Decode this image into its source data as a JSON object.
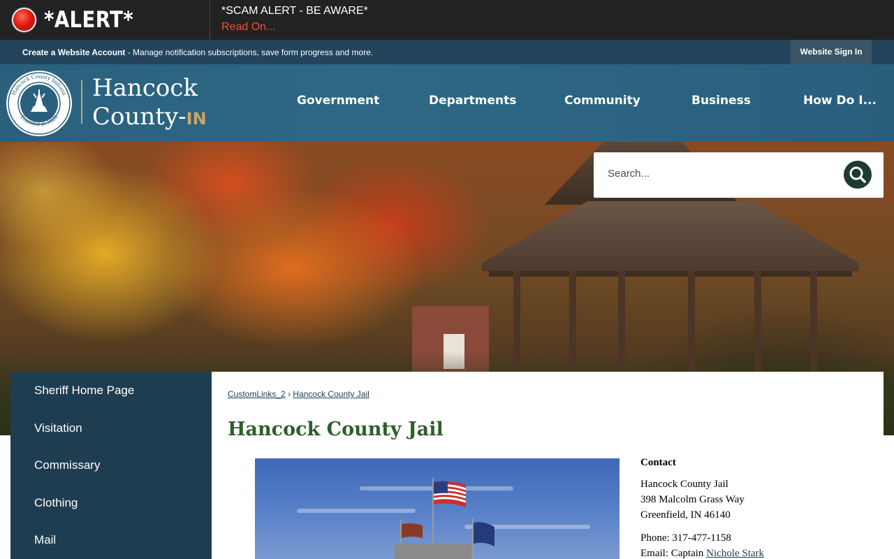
{
  "alert": {
    "title": "*ALERT*",
    "headline": "*SCAM ALERT - BE AWARE*",
    "link_label": "Read On..."
  },
  "account_bar": {
    "create_account_label": "Create a Website Account",
    "description": " - Manage notification subscriptions, save form progress and more.",
    "sign_in_label": "Website Sign In"
  },
  "header": {
    "seal_text_top": "Hancock County Indiana",
    "seal_text_bottom": "Founded in 1828",
    "logo_line1": "Hancock",
    "logo_line2": "County-",
    "logo_suffix": "IN",
    "nav": [
      "Government",
      "Departments",
      "Community",
      "Business",
      "How Do I..."
    ]
  },
  "search": {
    "placeholder": "Search..."
  },
  "sidebar": {
    "items": [
      "Sheriff Home Page",
      "Visitation",
      "Commissary",
      "Clothing",
      "Mail"
    ]
  },
  "breadcrumb": {
    "items": [
      "CustomLinks_2",
      "Hancock County Jail"
    ],
    "separator": "›"
  },
  "page": {
    "title": "Hancock County Jail"
  },
  "contact": {
    "heading": "Contact",
    "name": "Hancock County Jail",
    "address1": "398 Malcolm Grass Way",
    "address2": "Greenfield, IN 46140",
    "phone": "Phone: 317-477-1158",
    "email_prefix": "Email: Captain ",
    "email_name": "Nichole Stark"
  },
  "colors": {
    "alert_bg": "#222222",
    "alert_link": "#e9503d",
    "account_bar_bg": "#23445a",
    "header_bg": "#2d6885",
    "sidebar_bg": "#1f3d50",
    "title_green": "#2e5e2b",
    "logo_accent": "#c9a46a"
  }
}
